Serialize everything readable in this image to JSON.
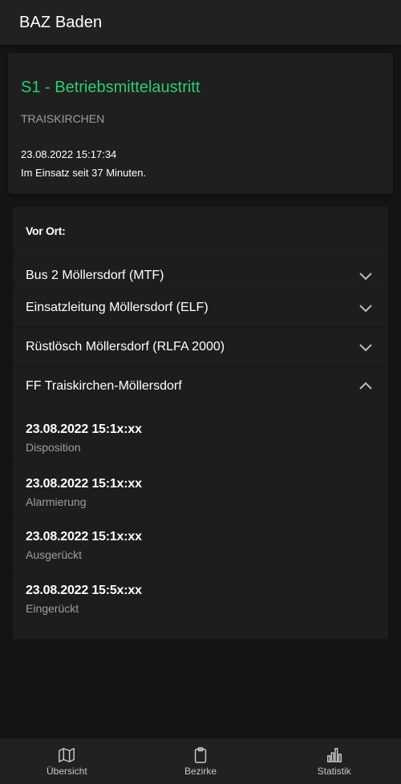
{
  "appbar": {
    "title": "BAZ Baden"
  },
  "incident": {
    "title": "S1 - Betriebsmittelaustritt",
    "location": "TRAISKIRCHEN",
    "time": "23.08.2022 15:17:34",
    "duration": "Im Einsatz seit 37 Minuten."
  },
  "panel": {
    "header": "Vor Ort:",
    "units": [
      {
        "label": "Bus 2 Möllersdorf (MTF)",
        "icon": "chevron-down-icon"
      },
      {
        "label": "Einsatzleitung Möllersdorf (ELF)",
        "icon": "chevron-down-icon"
      },
      {
        "label": "Rüstlösch Möllersdorf (RLFA 2000)",
        "icon": "chevron-down-icon"
      },
      {
        "label": "FF Traiskirchen-Möllersdorf",
        "icon": "chevron-up-icon"
      }
    ],
    "timeline": [
      {
        "time": "23.08.2022 15:1x:xx",
        "label": "Disposition"
      },
      {
        "time": "23.08.2022 15:1x:xx",
        "label": "Alarmierung"
      },
      {
        "time": "23.08.2022 15:1x:xx",
        "label": "Ausgerückt"
      },
      {
        "time": "23.08.2022 15:5x:xx",
        "label": "Eingerückt"
      }
    ]
  },
  "bottomnav": {
    "items": [
      {
        "label": "Übersicht",
        "icon": "map-icon"
      },
      {
        "label": "Bezirke",
        "icon": "clipboard-icon"
      },
      {
        "label": "Statistik",
        "icon": "bar-chart-icon"
      }
    ]
  },
  "colors": {
    "accent": "#2ecc71",
    "background": "#141414",
    "surface": "#1f1f1f"
  }
}
